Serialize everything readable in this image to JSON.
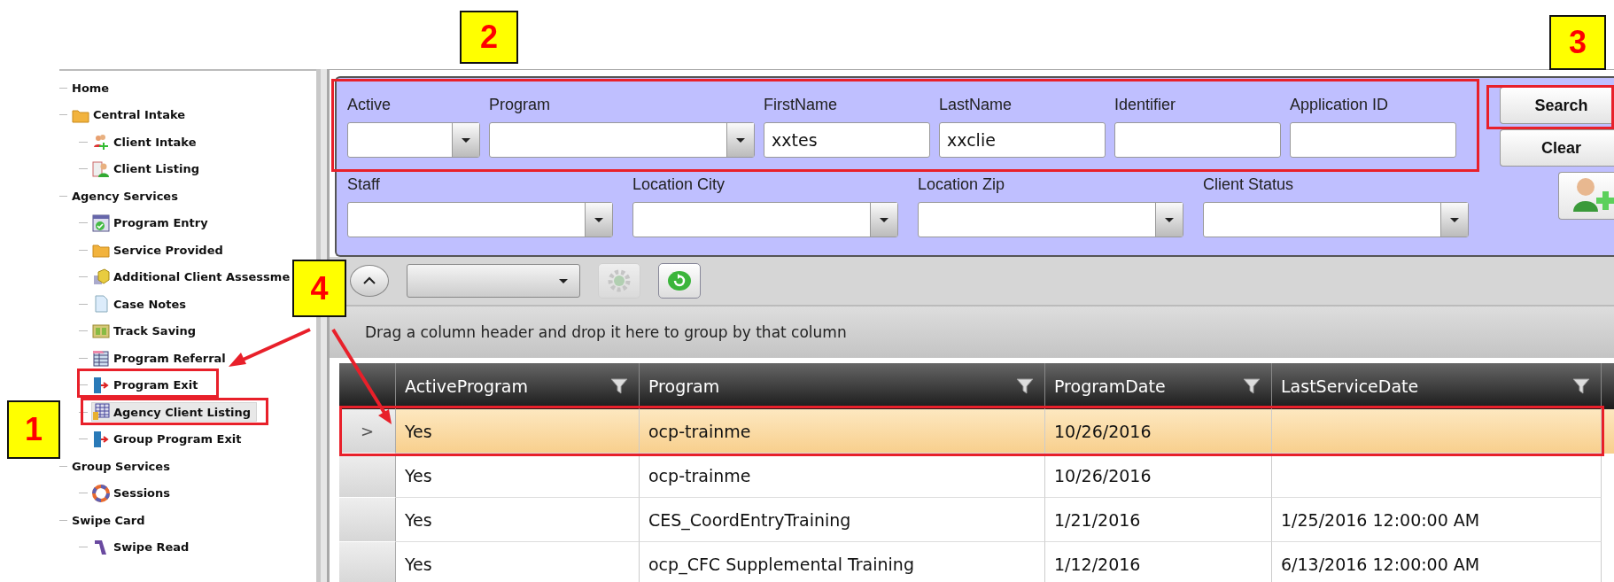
{
  "sidebar": {
    "items": [
      {
        "label": "Home",
        "selected": false
      },
      {
        "label": "Central Intake",
        "selected": false,
        "children": [
          {
            "label": "Client Intake",
            "selected": false
          },
          {
            "label": "Client Listing",
            "selected": false
          }
        ]
      },
      {
        "label": "Agency Services",
        "selected": false,
        "children": [
          {
            "label": "Program Entry",
            "selected": false
          },
          {
            "label": "Service Provided",
            "selected": false
          },
          {
            "label": "Additional Client Assessme",
            "selected": false
          },
          {
            "label": "Case Notes",
            "selected": false
          },
          {
            "label": "Track Saving",
            "selected": false
          },
          {
            "label": "Program Referral",
            "selected": false
          },
          {
            "label": "Program Exit",
            "selected": false
          },
          {
            "label": "Agency Client Listing",
            "selected": true
          },
          {
            "label": "Group Program Exit",
            "selected": false
          }
        ]
      },
      {
        "label": "Group Services",
        "selected": false,
        "children": [
          {
            "label": "Sessions",
            "selected": false
          }
        ]
      },
      {
        "label": "Swipe Card",
        "selected": false,
        "children": [
          {
            "label": "Swipe Read",
            "selected": false
          }
        ]
      }
    ]
  },
  "search_panel": {
    "top_fields": [
      {
        "kind": "combo",
        "label": "Active"
      },
      {
        "kind": "combo",
        "label": "Program"
      },
      {
        "kind": "text",
        "label": "FirstName",
        "value": "xxtes"
      },
      {
        "kind": "text",
        "label": "LastName",
        "value": "xxclie"
      },
      {
        "kind": "text",
        "label": "Identifier"
      },
      {
        "kind": "text",
        "label": "Application ID"
      }
    ],
    "bottom_fields": [
      {
        "kind": "combo",
        "label": "Staff"
      },
      {
        "kind": "combo",
        "label": "Location City"
      },
      {
        "kind": "combo",
        "label": "Location Zip"
      },
      {
        "kind": "combo",
        "label": "Client Status"
      }
    ],
    "buttons": [
      "Search",
      "Clear"
    ]
  },
  "group_bar": {
    "hint": "Drag a column header and drop it here to group by that column"
  },
  "grid": {
    "row_marker": ">",
    "columns": [
      "ActiveProgram",
      "Program",
      "ProgramDate",
      "LastServiceDate"
    ],
    "rows": [
      {
        "selected": true,
        "cells": [
          "Yes",
          "ocp-trainme",
          "10/26/2016",
          ""
        ]
      },
      {
        "selected": false,
        "cells": [
          "Yes",
          "ocp-trainme",
          "10/26/2016",
          ""
        ]
      },
      {
        "selected": false,
        "cells": [
          "Yes",
          "CES_CoordEntryTraining",
          "1/21/2016",
          "1/25/2016 12:00:00 AM"
        ]
      },
      {
        "selected": false,
        "cells": [
          "Yes",
          "ocp_CFC Supplemental Training",
          "1/12/2016",
          "6/13/2016 12:00:00 AM"
        ]
      }
    ]
  },
  "annotations": [
    {
      "label": "1"
    },
    {
      "label": "2"
    },
    {
      "label": "3"
    },
    {
      "label": "4"
    }
  ]
}
